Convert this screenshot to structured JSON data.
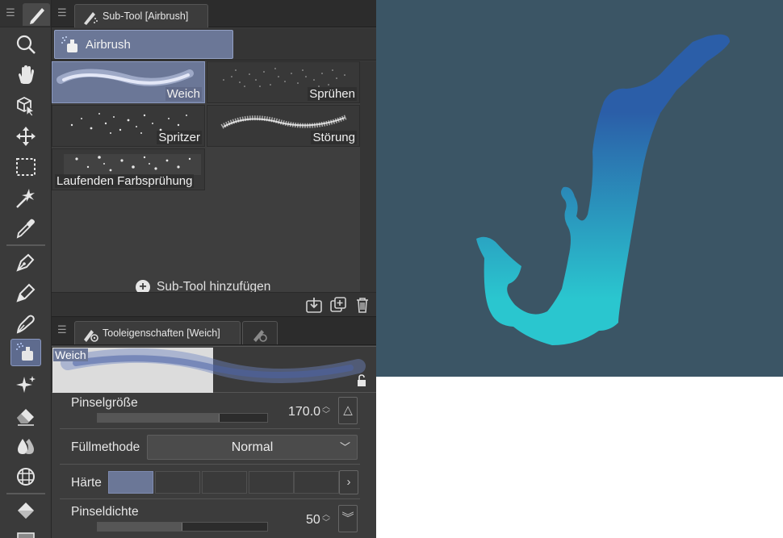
{
  "toolbar": {
    "menu_icon": "hamburger-icon",
    "header_icon": "pen-icon",
    "tools": [
      {
        "name": "zoom",
        "icon": "magnifier-icon"
      },
      {
        "name": "hand",
        "icon": "hand-icon"
      },
      {
        "name": "object",
        "icon": "cube-arrow-icon"
      },
      {
        "name": "move",
        "icon": "move-arrows-icon"
      },
      {
        "name": "selection",
        "icon": "dashed-rect-icon"
      },
      {
        "name": "auto-select",
        "icon": "magic-wand-icon"
      },
      {
        "name": "eyedropper",
        "icon": "eyedropper-icon"
      },
      {
        "name": "pen",
        "icon": "pen-nib-icon"
      },
      {
        "name": "pencil",
        "icon": "pencil-nib-icon"
      },
      {
        "name": "brush",
        "icon": "brush-nib-icon"
      },
      {
        "name": "airbrush",
        "icon": "airbrush-icon",
        "selected": true
      },
      {
        "name": "decoration",
        "icon": "sparkle-icon"
      },
      {
        "name": "eraser",
        "icon": "eraser-icon"
      },
      {
        "name": "blend",
        "icon": "blend-drops-icon"
      },
      {
        "name": "figure",
        "icon": "figure-grid-icon"
      },
      {
        "name": "fill",
        "icon": "fill-bucket-icon"
      },
      {
        "name": "gradient",
        "icon": "gradient-icon"
      }
    ]
  },
  "subtool": {
    "tab_label": "Sub-Tool [Airbrush]",
    "group_label": "Airbrush",
    "brushes": [
      {
        "label": "Weich",
        "selected": true
      },
      {
        "label": "Sprühen"
      },
      {
        "label": "Spritzer"
      },
      {
        "label": "Störung"
      },
      {
        "label": "Laufenden Farbsprühung"
      }
    ],
    "add_label": "Sub-Tool hinzufügen"
  },
  "toolprop": {
    "tab_label": "Tooleigenschaften [Weich]",
    "preview_name": "Weich",
    "brush_size_label": "Pinselgröße",
    "brush_size_value": "170.0",
    "brush_size_fraction": 0.72,
    "fill_label": "Füllmethode",
    "fill_value": "Normal",
    "hardness_label": "Härte",
    "hardness_selected_index": 0,
    "hardness_segments": 5,
    "density_label": "Pinseldichte",
    "density_value": "50",
    "density_fraction": 0.5
  },
  "colors": {
    "canvas_bg": "#3b5565",
    "blob_top": "#2b5ea8",
    "blob_bottom": "#2ac6cf",
    "selected_accent": "#6b7797"
  }
}
